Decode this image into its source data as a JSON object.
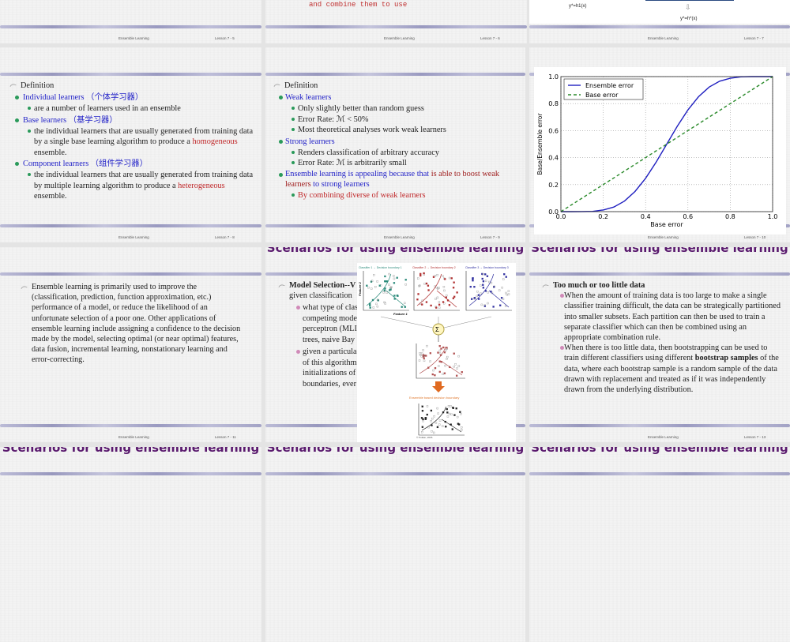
{
  "footer_title": "Ensemble Learning",
  "scenario_title": "Scenarios for using ensemble learning",
  "slides": {
    "s5": {
      "lesson": "Lesson 7 - 5"
    },
    "s6": {
      "lesson": "Lesson 7 - 6",
      "partial_text": "and combine them to use"
    },
    "s7": {
      "lesson": "Lesson 7 - 7",
      "eq1": "y*=h1(x)",
      "eq2": "y*=h*(x)"
    },
    "s8": {
      "lesson": "Lesson 7 - 8",
      "heading": "Definition",
      "items": [
        {
          "label": "Individual learners",
          "cn": "（个体学习器）",
          "sub": "are a number of learners used in an ensemble"
        },
        {
          "label": "Base learners",
          "cn": "（基学习器）",
          "sub_a": "the individual learners that are usually generated from training data by a single base learning algorithm to produce a ",
          "sub_hl": "homogeneous",
          "sub_b": " ensemble."
        },
        {
          "label": "Component learners",
          "cn": "（组件学习器）",
          "sub_a": "the individual learners that are usually generated from training data by multiple learning algorithm to produce a ",
          "sub_hl": "heterogeneous",
          "sub_b": " ensemble."
        }
      ]
    },
    "s9": {
      "lesson": "Lesson 7 - 9",
      "heading": "Definition",
      "weak": "Weak learners",
      "weak_items": [
        "Only slightly better than random guess",
        "Error Rate: ℳ  < 50%",
        "Most theoretical analyses work weak learners"
      ],
      "strong": "Strong learners",
      "strong_items": [
        "Renders classification of arbitrary accuracy",
        "Error Rate: ℳ is arbitrarily small"
      ],
      "appeal_a": "Ensemble learning is appealing because that ",
      "appeal_b": "is able to boost weak learners ",
      "appeal_c": "to strong learners",
      "combine": "By combining diverse of weak learners"
    },
    "s10": {
      "lesson": "Lesson 7 - 10"
    },
    "s11": {
      "lesson": "Lesson 7 - 11",
      "text": "Ensemble learning is primarily used to improve the (classification, prediction, function approximation, etc.) performance of a model, or reduce the likelihood of an unfortunate selection of a poor one. Other applications of ensemble learning include assigning a confidence to the decision made by the model, selecting optimal (or near optimal) features, data fusion, incremental learning, nonstationary learning and error-correcting."
    },
    "s12": {
      "heading": "Model Selection--V",
      "heading2": "given classification",
      "b1": [
        "what type of clas",
        "competing mode",
        "perceptron (MLI",
        "trees, naive Bay"
      ],
      "b2": [
        "given a particula",
        "of this algorithm",
        "initializations of",
        "boundaries, ever"
      ],
      "fig": {
        "c1": "Classifier 1 → Decision boundary 1",
        "c2": "Classifier 2 → Decision boundary 2",
        "c3": "Classifier 3 → Decision boundary 3",
        "f1": "Feature 1",
        "f2": "Feature 2",
        "sum": "Σ",
        "ens": "Ensemble based decision boundary",
        "credit": "© Polikar, 2006"
      }
    },
    "s13": {
      "lesson": "Lesson 7 - 13",
      "heading": "Too much or too little data",
      "b1": "When the amount of training data is too large to make a single classifier training difficult, the data can be strategically partitioned into smaller subsets. Each partition can then be used to train a separate classifier which can then be combined using an appropriate combination rule.",
      "b2_a": "When there is too little data, then bootstrapping can be used to train different classifiers using different ",
      "b2_bold": "bootstrap samples",
      "b2_b": " of the data, where each bootstrap sample is a random sample of the data drawn with replacement and treated as if it was independently drawn from the underlying distribution."
    }
  },
  "chart_data": {
    "type": "line",
    "xlabel": "Base error",
    "ylabel": "Base/Ensemble error",
    "xlim": [
      0,
      1
    ],
    "ylim": [
      0,
      1
    ],
    "grid": true,
    "legend": "top-left",
    "xticks": [
      "0.0",
      "0.2",
      "0.4",
      "0.6",
      "0.8",
      "1.0"
    ],
    "yticks": [
      "0.0",
      "0.2",
      "0.4",
      "0.6",
      "0.8",
      "1.0"
    ],
    "x": [
      0,
      0.05,
      0.1,
      0.15,
      0.2,
      0.25,
      0.3,
      0.35,
      0.4,
      0.45,
      0.5,
      0.55,
      0.6,
      0.65,
      0.7,
      0.75,
      0.8,
      0.85,
      0.9,
      0.95,
      1
    ],
    "series": [
      {
        "name": "Ensemble error",
        "color": "#2020c0",
        "style": "solid",
        "values": [
          0,
          0,
          0.0003,
          0.002,
          0.012,
          0.034,
          0.078,
          0.149,
          0.247,
          0.367,
          0.5,
          0.633,
          0.753,
          0.851,
          0.922,
          0.966,
          0.988,
          0.998,
          1,
          1,
          1
        ]
      },
      {
        "name": "Base error",
        "color": "#2a8a2a",
        "style": "dashed",
        "values": [
          0,
          0.05,
          0.1,
          0.15,
          0.2,
          0.25,
          0.3,
          0.35,
          0.4,
          0.45,
          0.5,
          0.55,
          0.6,
          0.65,
          0.7,
          0.75,
          0.8,
          0.85,
          0.9,
          0.95,
          1
        ]
      }
    ]
  }
}
